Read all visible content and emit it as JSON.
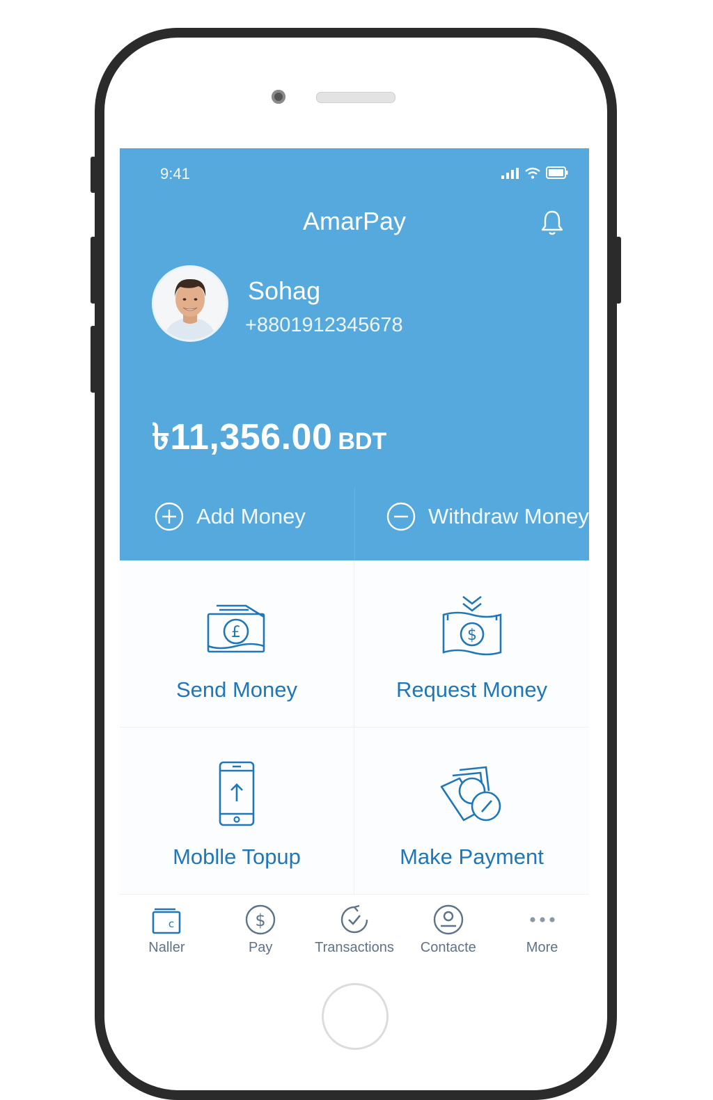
{
  "status_bar": {
    "time": "9:41"
  },
  "app": {
    "title": "AmarPay"
  },
  "user": {
    "name": "Sohag",
    "phone": "+8801912345678"
  },
  "balance": {
    "amount": "৳11,356.00",
    "currency": "BDT"
  },
  "actions": {
    "add_money": "Add Money",
    "withdraw_money": "Withdraw Money"
  },
  "tiles": [
    {
      "label": "Send Money",
      "icon": "send-money-icon"
    },
    {
      "label": "Request Money",
      "icon": "request-money-icon"
    },
    {
      "label": "Moblle Topup",
      "icon": "mobile-topup-icon"
    },
    {
      "label": "Make Payment",
      "icon": "make-payment-icon"
    }
  ],
  "bottom_nav": [
    {
      "label": "Naller",
      "icon": "wallet-icon"
    },
    {
      "label": "Pay",
      "icon": "dollar-circle-icon"
    },
    {
      "label": "Transactions",
      "icon": "transactions-icon"
    },
    {
      "label": "Contacte",
      "icon": "contact-icon"
    },
    {
      "label": "More",
      "icon": "more-dots-icon"
    }
  ],
  "colors": {
    "header_bg": "#55a9dc",
    "accent": "#1f77b8",
    "nav_text": "#5f7386"
  }
}
